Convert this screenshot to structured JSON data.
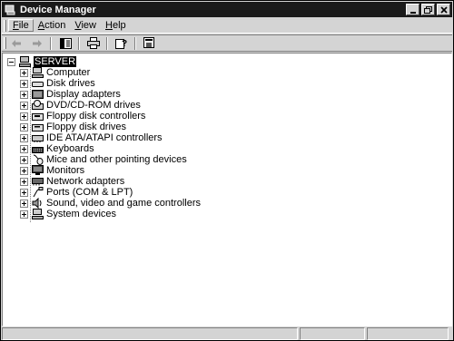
{
  "window": {
    "title": "Device Manager"
  },
  "menus": [
    {
      "label": "File",
      "hotkey": "F",
      "rest": "ile"
    },
    {
      "label": "Action",
      "hotkey": "A",
      "rest": "ction"
    },
    {
      "label": "View",
      "hotkey": "V",
      "rest": "iew"
    },
    {
      "label": "Help",
      "hotkey": "H",
      "rest": "elp"
    }
  ],
  "toolbar": {
    "buttons": [
      "back-icon",
      "forward-icon",
      "show-hide-tree-icon",
      "print-icon",
      "help-icon",
      "properties-icon"
    ]
  },
  "tree": {
    "root": {
      "label": "SERVER",
      "icon": "computer-icon"
    },
    "items": [
      {
        "label": "Computer",
        "icon": "computer-icon"
      },
      {
        "label": "Disk drives",
        "icon": "disk-drive-icon"
      },
      {
        "label": "Display adapters",
        "icon": "display-adapter-icon"
      },
      {
        "label": "DVD/CD-ROM drives",
        "icon": "cdrom-icon"
      },
      {
        "label": "Floppy disk controllers",
        "icon": "floppy-controller-icon"
      },
      {
        "label": "Floppy disk drives",
        "icon": "floppy-drive-icon"
      },
      {
        "label": "IDE ATA/ATAPI controllers",
        "icon": "ide-controller-icon"
      },
      {
        "label": "Keyboards",
        "icon": "keyboard-icon"
      },
      {
        "label": "Mice and other pointing devices",
        "icon": "mouse-icon"
      },
      {
        "label": "Monitors",
        "icon": "monitor-icon"
      },
      {
        "label": "Network adapters",
        "icon": "network-adapter-icon"
      },
      {
        "label": "Ports (COM & LPT)",
        "icon": "port-icon"
      },
      {
        "label": "Sound, video and game controllers",
        "icon": "sound-icon"
      },
      {
        "label": "System devices",
        "icon": "system-devices-icon"
      }
    ]
  }
}
